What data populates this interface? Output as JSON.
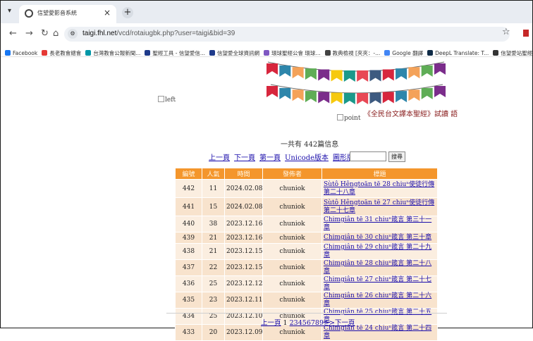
{
  "browser": {
    "tab_title": "信望愛影音系統",
    "tab_close": "×",
    "new_tab": "+",
    "url_host": "taigi.fhl.net",
    "url_path": "/vcd/rotaiugbk.php?user=taigi&bid=39",
    "bookmarks": [
      {
        "label": "Facebook",
        "color": "#1877f2"
      },
      {
        "label": "長老教會總會",
        "color": "#e53935"
      },
      {
        "label": "台灣教會公報新聞...",
        "color": "#0097a7"
      },
      {
        "label": "聖經工具 - 信望愛信...",
        "color": "#1e3a8a"
      },
      {
        "label": "信望愛全球資訊網",
        "color": "#1e3a8a"
      },
      {
        "label": "環球聖經公會 環球...",
        "color": "#7e57c2"
      },
      {
        "label": "教典檢視 [夾夾：-...",
        "color": "#424242"
      },
      {
        "label": "Google 翻譯",
        "color": "#4285f4"
      },
      {
        "label": "DeepL Translate: T...",
        "color": "#0f2b46"
      },
      {
        "label": "信望愛站聖經寶可...",
        "color": "#333333"
      }
    ]
  },
  "page": {
    "left_img_alt": "left",
    "point_img_alt": "point",
    "reader_text": "《全民台文譯本聖經》試讀 語",
    "count_text": "一共有 442篇信息",
    "links": {
      "prev": "上一頁",
      "next": "下一頁",
      "first": "第一頁",
      "unicode": "Unicode版本",
      "image": "圖形版本"
    },
    "search_button": "搜尋",
    "columns": [
      "編號",
      "人氣",
      "時間",
      "發佈者",
      "標題"
    ],
    "rows": [
      {
        "id": "442",
        "views": "11",
        "date": "2024.02.08",
        "author": "chuniok",
        "title": "Sùtô Hêngtoān tē 28 chiuⁿ使徒行傳 第二十八章"
      },
      {
        "id": "441",
        "views": "15",
        "date": "2024.02.08",
        "author": "chuniok",
        "title": "Sùtô Hêngtoān tē 27 chiuⁿ使徒行傳 第二十七章"
      },
      {
        "id": "440",
        "views": "38",
        "date": "2023.12.16",
        "author": "chuniok",
        "title": "Chimgiân tē 31 chiuⁿ箴言 第三十一章"
      },
      {
        "id": "439",
        "views": "21",
        "date": "2023.12.16",
        "author": "chuniok",
        "title": "Chimgiân tē 30 chiuⁿ箴言 第三十章"
      },
      {
        "id": "438",
        "views": "21",
        "date": "2023.12.15",
        "author": "chuniok",
        "title": "Chimgiân tē 29 chiuⁿ箴言 第二十九章"
      },
      {
        "id": "437",
        "views": "22",
        "date": "2023.12.15",
        "author": "chuniok",
        "title": "Chimgiân tē 28 chiuⁿ箴言 第二十八章"
      },
      {
        "id": "436",
        "views": "25",
        "date": "2023.12.12",
        "author": "chuniok",
        "title": "Chimgiân tē 27 chiuⁿ箴言 第二十七章"
      },
      {
        "id": "435",
        "views": "23",
        "date": "2023.12.11",
        "author": "chuniok",
        "title": "Chimgiân tē 26 chiuⁿ箴言 第二十六章"
      },
      {
        "id": "434",
        "views": "25",
        "date": "2023.12.10",
        "author": "chuniok",
        "title": "Chimgiân tē 25 chiuⁿ箴言 第二十五章"
      },
      {
        "id": "433",
        "views": "20",
        "date": "2023.12.09",
        "author": "chuniok",
        "title": "Chimgiân tē 24 chiuⁿ箴言 第二十四章"
      }
    ],
    "pager": {
      "prev": "上一頁",
      "current": "1",
      "pages": [
        "2",
        "3",
        "4",
        "5",
        "6",
        "7",
        "8",
        "9"
      ],
      "more": ">>",
      "next": "下一頁"
    }
  }
}
